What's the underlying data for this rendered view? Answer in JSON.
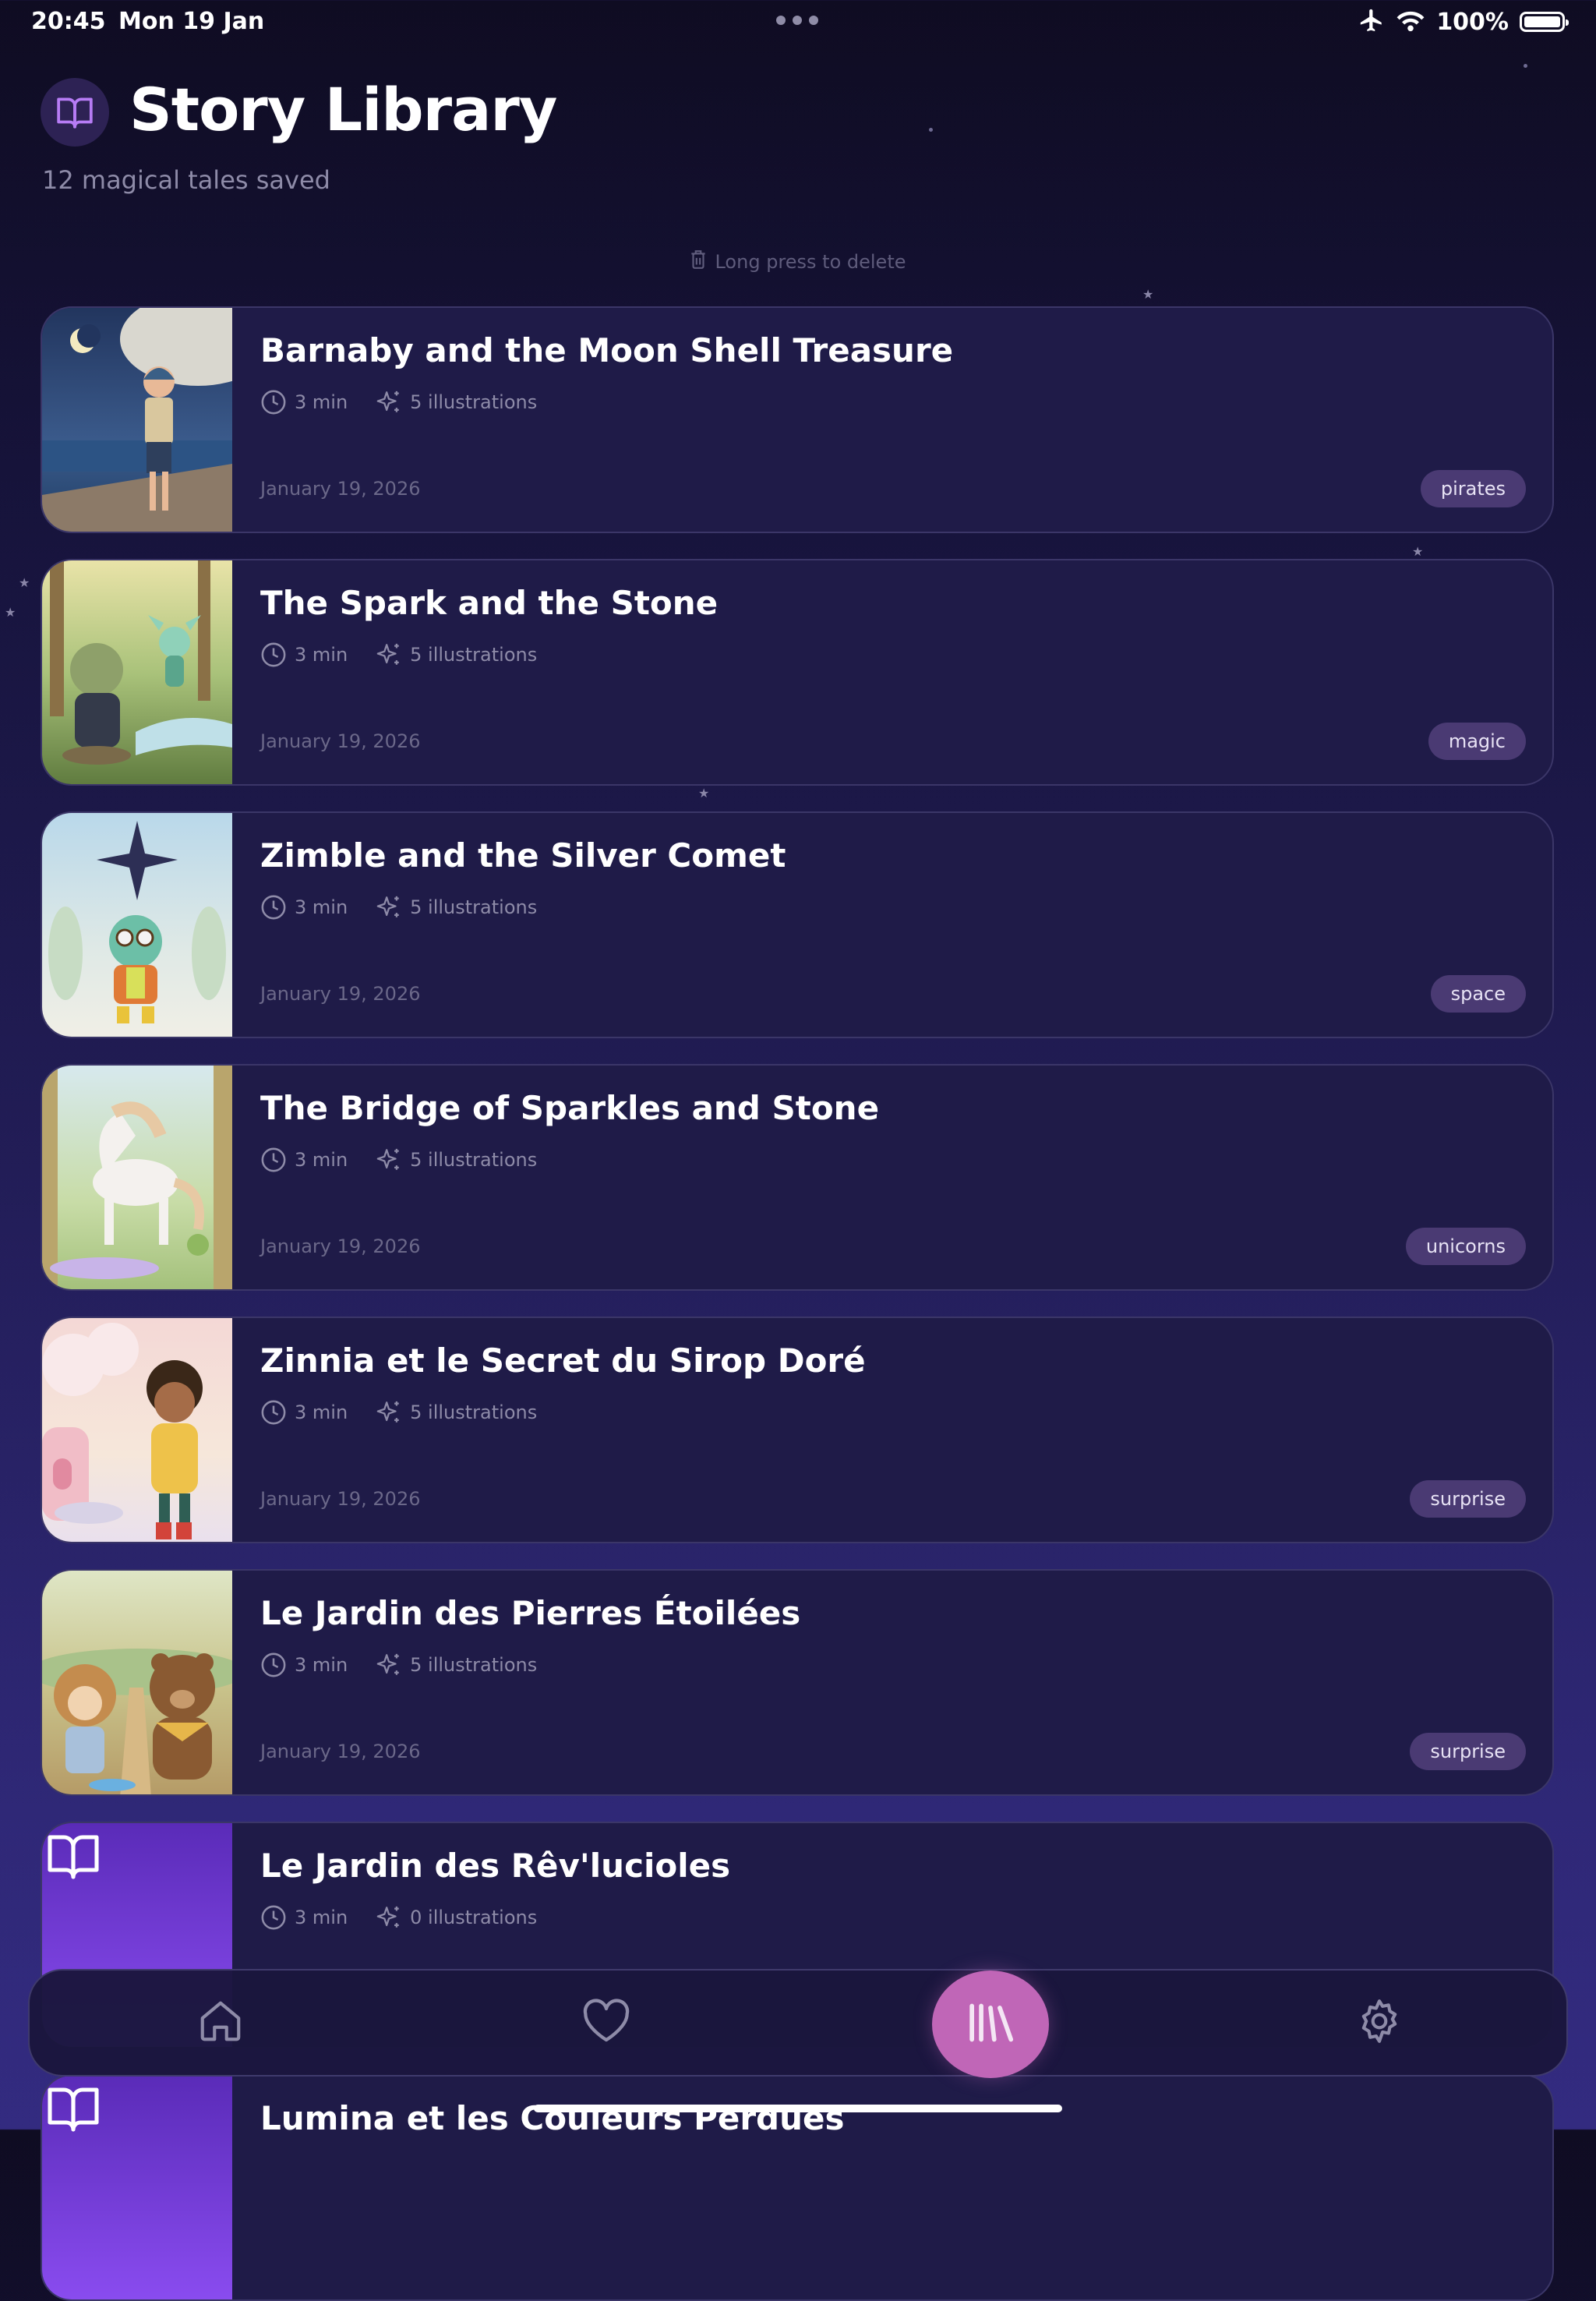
{
  "status_bar": {
    "time": "20:45",
    "date": "Mon 19 Jan",
    "battery": "100%",
    "icons": [
      "airplane-icon",
      "wifi-icon",
      "battery-icon"
    ]
  },
  "header": {
    "icon": "book-icon",
    "title": "Story Library",
    "subtitle": "12 magical tales saved"
  },
  "hint": {
    "icon": "trash-icon",
    "text": "Long press to delete"
  },
  "stories": [
    {
      "title": "Barnaby and the Moon Shell Treasure",
      "duration": "3 min",
      "illustrations": "5 illustrations",
      "date": "January 19, 2026",
      "tag": "pirates"
    },
    {
      "title": "The Spark and the Stone",
      "duration": "3 min",
      "illustrations": "5 illustrations",
      "date": "January 19, 2026",
      "tag": "magic"
    },
    {
      "title": "Zimble and the Silver Comet",
      "duration": "3 min",
      "illustrations": "5 illustrations",
      "date": "January 19, 2026",
      "tag": "space"
    },
    {
      "title": "The Bridge of Sparkles and Stone",
      "duration": "3 min",
      "illustrations": "5 illustrations",
      "date": "January 19, 2026",
      "tag": "unicorns"
    },
    {
      "title": "Zinnia et le Secret du Sirop Doré",
      "duration": "3 min",
      "illustrations": "5 illustrations",
      "date": "January 19, 2026",
      "tag": "surprise"
    },
    {
      "title": "Le Jardin des Pierres Étoilées",
      "duration": "3 min",
      "illustrations": "5 illustrations",
      "date": "January 19, 2026",
      "tag": "surprise"
    },
    {
      "title": "Le Jardin des Rêv'lucioles",
      "duration": "3 min",
      "illustrations": "0 illustrations"
    },
    {
      "title": "Lumina et les Couleurs Perdues"
    }
  ],
  "nav": {
    "items": [
      "home-icon",
      "heart-icon",
      "library-icon",
      "settings-icon"
    ],
    "active": "library-icon"
  },
  "colors": {
    "background_top": "#0f0c22",
    "background_bottom": "#332b80",
    "card": "#1f1b48",
    "tag": "#4a3a73",
    "accent": "#c066b7",
    "placeholder_purple": "#7b3fe4"
  }
}
